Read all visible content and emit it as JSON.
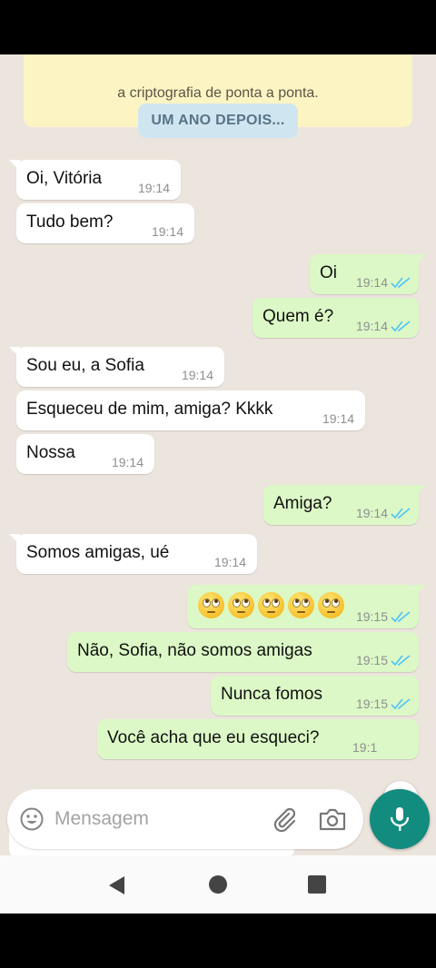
{
  "encryption_notice": "a criptografia de ponta a ponta.",
  "date_divider": "UM ANO DEPOIS...",
  "messages": [
    {
      "text": "Oi, Vitória",
      "time": "19:14",
      "direction": "in"
    },
    {
      "text": "Tudo bem?",
      "time": "19:14",
      "direction": "in"
    },
    {
      "text": "Oi",
      "time": "19:14",
      "direction": "out"
    },
    {
      "text": "Quem é?",
      "time": "19:14",
      "direction": "out"
    },
    {
      "text": "Sou eu, a Sofia",
      "time": "19:14",
      "direction": "in"
    },
    {
      "text": "Esqueceu de mim, amiga? Kkkk",
      "time": "19:14",
      "direction": "in"
    },
    {
      "text": "Nossa",
      "time": "19:14",
      "direction": "in"
    },
    {
      "text": "Amiga?",
      "time": "19:14",
      "direction": "out"
    },
    {
      "text": "Somos amigas, ué",
      "time": "19:14",
      "direction": "in"
    },
    {
      "text": "🙄🙄🙄🙄🙄",
      "time": "19:15",
      "direction": "out"
    },
    {
      "text": "Não, Sofia, não somos amigas",
      "time": "19:15",
      "direction": "out"
    },
    {
      "text": "Nunca fomos",
      "time": "19:15",
      "direction": "out"
    },
    {
      "text": "Você acha que eu esqueci?",
      "time": "19:1",
      "direction": "out"
    }
  ],
  "input": {
    "placeholder": "Mensagem"
  },
  "icons": {
    "emoji": "emoji-icon",
    "attach": "paperclip-icon",
    "camera": "camera-icon",
    "mic": "microphone-icon",
    "scroll_down": "double-chevron-down-icon",
    "read_receipt": "double-check-icon"
  },
  "colors": {
    "chat_background": "#ece5dd",
    "incoming_bubble": "#ffffff",
    "outgoing_bubble": "#dcf8c6",
    "read_ticks": "#4fc3f7",
    "mic_button": "#128c7e",
    "date_pill": "#cfe6f1"
  }
}
